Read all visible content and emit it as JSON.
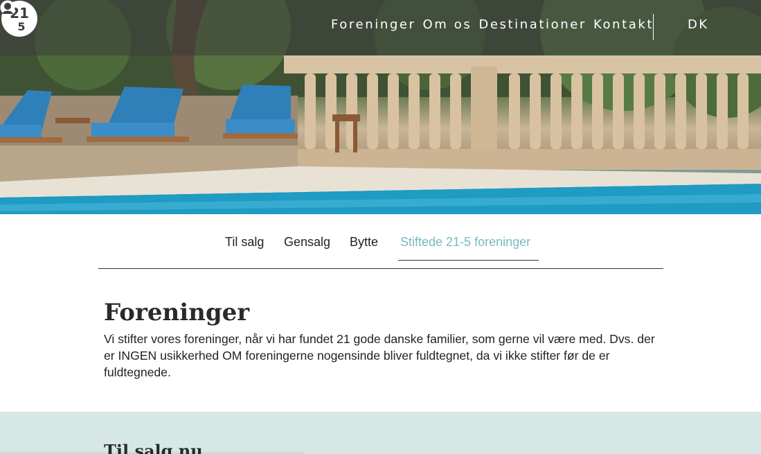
{
  "header": {
    "nav": [
      "Foreninger",
      "Om os",
      "Destinationer",
      "Kontakt"
    ],
    "lang": "DK"
  },
  "logo_icon": "logo-21-5-icon",
  "user_icon": "user-icon",
  "tabs": {
    "items": [
      "Til salg",
      "Gensalg",
      "Bytte",
      "Stiftede 21-5 foreninger"
    ],
    "active_index": 3
  },
  "main": {
    "title": "Foreninger",
    "body": "Vi stifter vores foreninger, når vi har fundet 21 gode danske familier, som gerne vil være med. Dvs. der er INGEN usikkerhed OM foreningerne nogensinde bliver fuldtegnet, da vi ikke stifter før de er fuldtegnede."
  },
  "band": {
    "title": "Til salg nu"
  },
  "colors": {
    "accent": "#7ab8c4",
    "band": "#d6e8e6",
    "pool": "#1b8fb3"
  }
}
